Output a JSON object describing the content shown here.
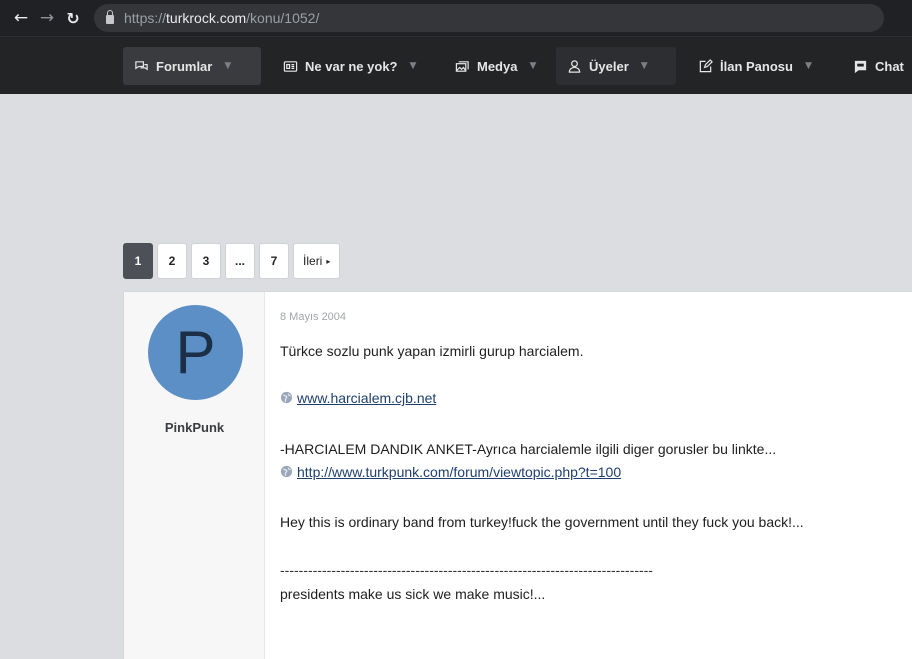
{
  "browser": {
    "url_protocol": "https://",
    "url_host": "turkrock.com",
    "url_path": "/konu/1052/"
  },
  "sitenav": {
    "items": [
      {
        "label": "Forumlar",
        "icon": "chat-bubbles-icon"
      },
      {
        "label": "Ne var ne yok?",
        "icon": "newspaper-icon"
      },
      {
        "label": "Medya",
        "icon": "images-icon"
      },
      {
        "label": "Üyeler",
        "icon": "user-icon"
      },
      {
        "label": "İlan Panosu",
        "icon": "edit-icon"
      },
      {
        "label": "Chat",
        "icon": "message-icon"
      }
    ]
  },
  "pagination": {
    "pages": [
      "1",
      "2",
      "3",
      "...",
      "7"
    ],
    "current": "1",
    "next_label": "İleri"
  },
  "post": {
    "username": "PinkPunk",
    "avatar_letter": "P",
    "avatar_color": "#5b8fc6",
    "date": "8 Mayıs 2004",
    "line1": "Türkce sozlu punk yapan izmirli gurup harcialem.",
    "link1": "www.harcialem.cjb.net",
    "line2": "-HARCIALEM DANDIK ANKET-Ayrıca harcialemle ilgili diger gorusler bu linkte...",
    "link2": "http://www.turkpunk.com/forum/viewtopic.php?t=100",
    "line3": "Hey this is ordinary band from turkey!fuck the government until they fuck you back!...",
    "divider": "--------------------------------------------------------------------------------",
    "line4": "presidents make us sick we make music!..."
  }
}
